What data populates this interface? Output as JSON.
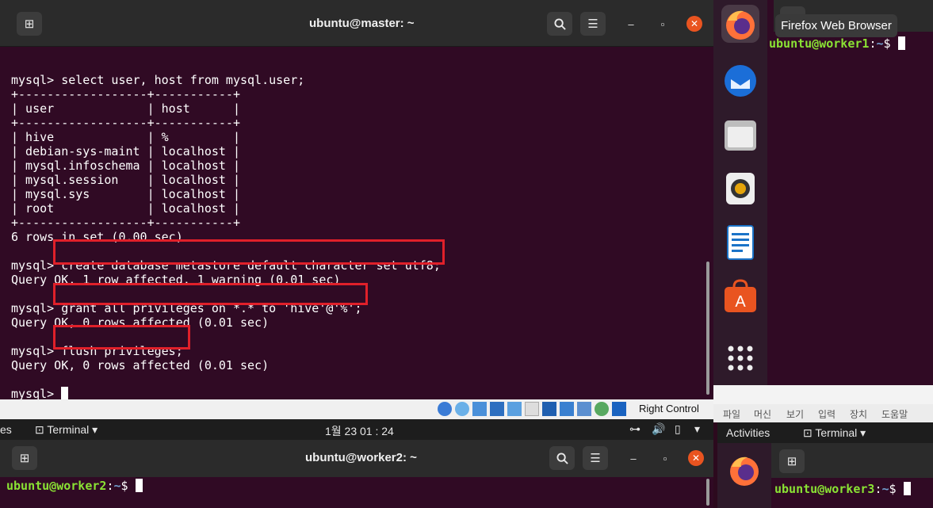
{
  "master": {
    "title": "ubuntu@master: ~",
    "lines": [
      "mysql> select user, host from mysql.user;",
      "+------------------+-----------+",
      "| user             | host      |",
      "+------------------+-----------+",
      "| hive             | %         |",
      "| debian-sys-maint | localhost |",
      "| mysql.infoschema | localhost |",
      "| mysql.session    | localhost |",
      "| mysql.sys        | localhost |",
      "| root             | localhost |",
      "+------------------+-----------+",
      "6 rows in set (0.00 sec)",
      "",
      "mysql> create database metastore default character set utf8;",
      "Query OK, 1 row affected, 1 warning (0.01 sec)",
      "",
      "mysql> grant all privileges on *.* to 'hive'@'%';",
      "Query OK, 0 rows affected (0.01 sec)",
      "",
      "mysql> flush privileges;",
      "Query OK, 0 rows affected (0.01 sec)",
      "",
      "mysql> "
    ]
  },
  "worker1": {
    "user": "ubuntu@worker1",
    "sep": ":",
    "path": "~",
    "prompt": "$ "
  },
  "tooltip": "Firefox Web Browser",
  "vbox": {
    "host_key": "Right Control"
  },
  "menubar": [
    "파일",
    "머신",
    "보기",
    "입력",
    "장치",
    "도움말"
  ],
  "panel2": {
    "left_frag": "es",
    "app": "Terminal",
    "clock": "1월 23  01 : 24"
  },
  "panel3": {
    "activities": "Activities",
    "app": "Terminal"
  },
  "worker2": {
    "title": "ubuntu@worker2: ~",
    "user": "ubuntu@worker2",
    "sep": ":",
    "path": "~",
    "prompt": "$ "
  },
  "worker3": {
    "user": "ubuntu@worker3",
    "sep": ":",
    "path": "~",
    "prompt": "$ "
  },
  "icons": {
    "new_tab": "new-tab-icon",
    "search": "search-icon",
    "menu": "hamburger-menu-icon",
    "minimize": "minimize-icon",
    "maximize": "maximize-icon",
    "close": "close-icon"
  },
  "colors": {
    "terminal_bg": "#300a24",
    "highlight": "#e0202a",
    "close": "#e95420"
  }
}
